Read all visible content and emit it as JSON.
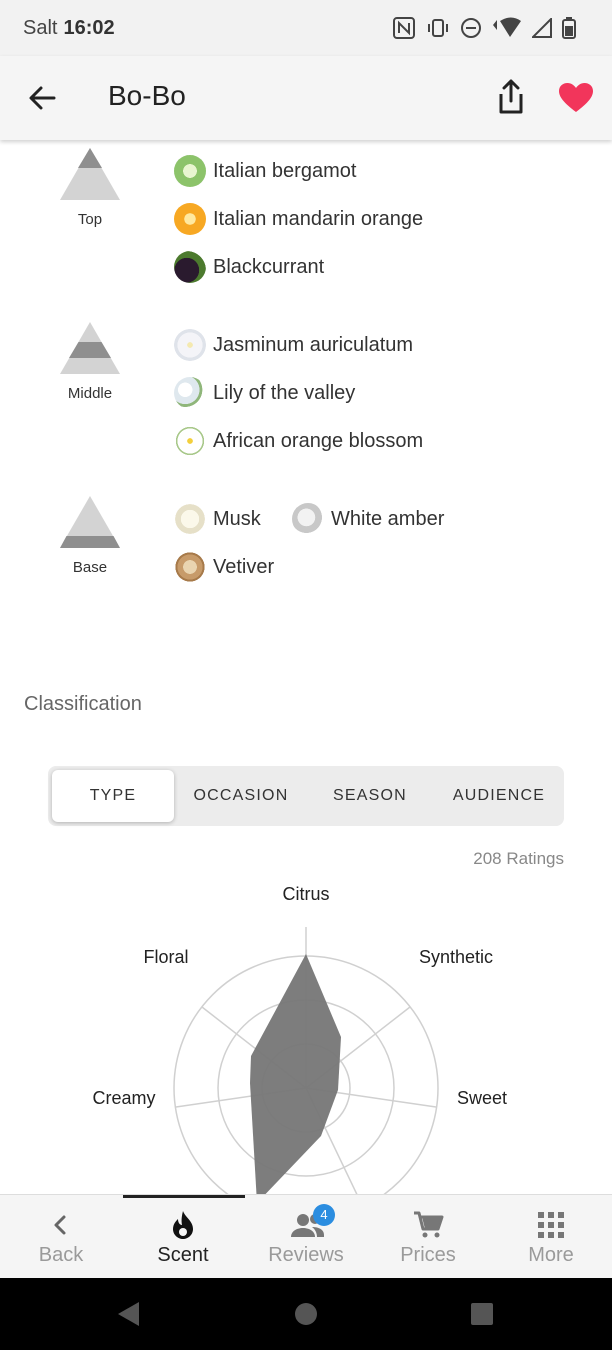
{
  "status_bar": {
    "carrier": "Salt",
    "time": "16:02"
  },
  "app_bar": {
    "title": "Bo-Bo",
    "heart_color": "#f2355b"
  },
  "pyramid": {
    "top": {
      "label": "Top",
      "notes": [
        "Italian bergamot",
        "Italian mandarin orange",
        "Blackcurrant"
      ]
    },
    "middle": {
      "label": "Middle",
      "notes": [
        "Jasminum auriculatum",
        "Lily of the valley",
        "African orange blossom"
      ]
    },
    "base": {
      "label": "Base",
      "notes": [
        "Musk",
        "White amber",
        "Vetiver"
      ]
    }
  },
  "classification": {
    "title": "Classification",
    "tabs": [
      "TYPE",
      "OCCASION",
      "SEASON",
      "AUDIENCE"
    ],
    "active_tab": "TYPE",
    "ratings_text": "208 Ratings"
  },
  "chart_data": {
    "type": "radar",
    "axes": [
      "Citrus",
      "Synthetic",
      "Sweet",
      "Creamy",
      "Floral"
    ],
    "visible_axis_labels": [
      "Citrus",
      "Floral",
      "Synthetic",
      "Creamy",
      "Sweet"
    ],
    "fill_color": "#767676"
  },
  "bottom_nav": {
    "items": [
      {
        "label": "Back",
        "icon": "chevron-left-icon"
      },
      {
        "label": "Scent",
        "icon": "flame-icon"
      },
      {
        "label": "Reviews",
        "icon": "people-icon",
        "badge": "4"
      },
      {
        "label": "Prices",
        "icon": "cart-icon"
      },
      {
        "label": "More",
        "icon": "grid-icon"
      }
    ],
    "active": "Scent"
  }
}
